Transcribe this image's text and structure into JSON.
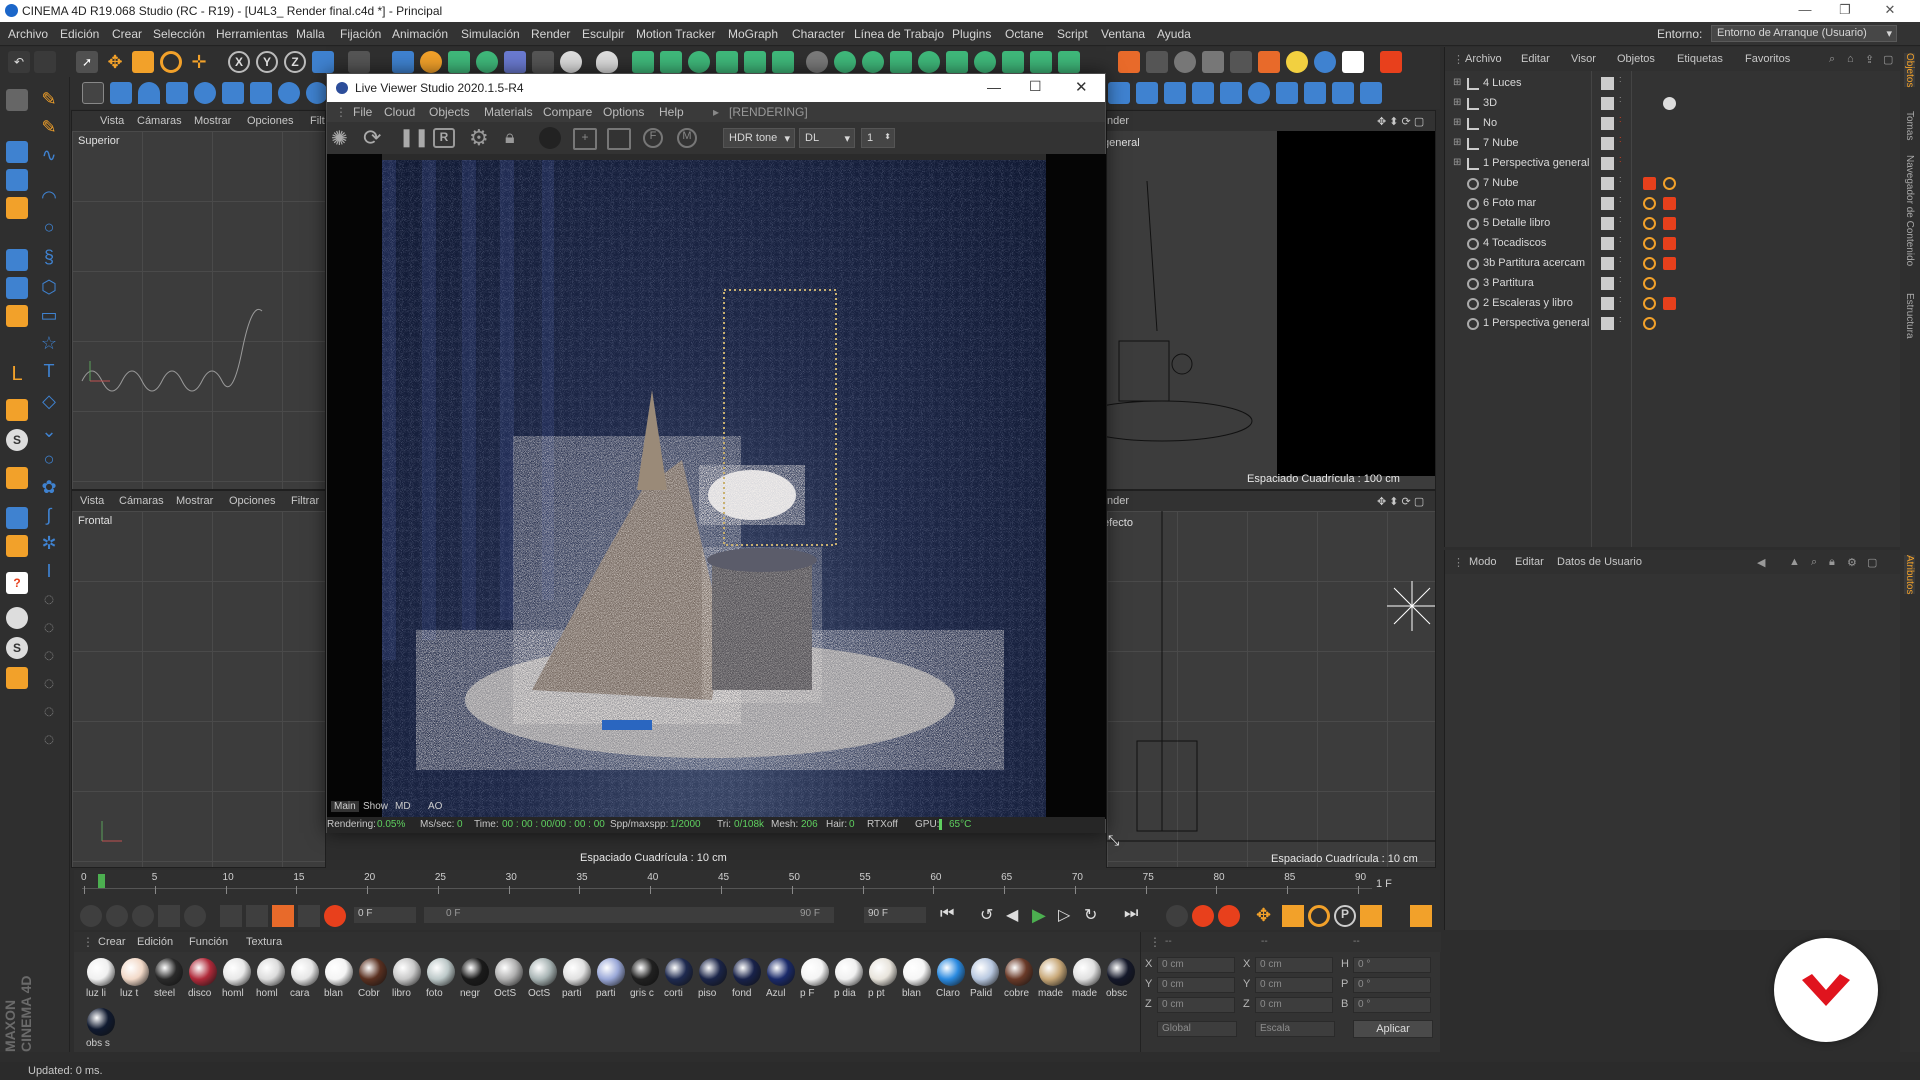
{
  "window": {
    "title": "CINEMA 4D R19.068 Studio (RC - R19) - [U4L3_ Render final.c4d *] - Principal"
  },
  "menubar": {
    "items": [
      "Archivo",
      "Edición",
      "Crear",
      "Selección",
      "Herramientas",
      "Malla",
      "Fijación",
      "Animación",
      "Simulación",
      "Render",
      "Esculpir",
      "Motion Tracker",
      "MoGraph",
      "Character",
      "Línea de Trabajo",
      "Plugins",
      "Octane",
      "Script",
      "Ventana",
      "Ayuda"
    ],
    "entorno_label": "Entorno:",
    "entorno_value": "Entorno de Arranque (Usuario)"
  },
  "viewports": {
    "top_left": {
      "menu": [
        "Vista",
        "Cámaras",
        "Mostrar",
        "Opciones",
        "Filt"
      ],
      "label": "Superior"
    },
    "bottom_left": {
      "menu": [
        "Vista",
        "Cámaras",
        "Mostrar",
        "Opciones",
        "Filtrar"
      ],
      "label": "Frontal",
      "grid_spacing": "Espaciado Cuadrícula : 10 cm"
    },
    "top_right": {
      "header": "nder",
      "camera": "general",
      "grid_spacing": "Espaciado Cuadrícula : 100 cm"
    },
    "bottom_right": {
      "header": "nder",
      "camera": "efecto",
      "grid_spacing": "Espaciado Cuadrícula : 10 cm"
    }
  },
  "live_viewer": {
    "title": "Live Viewer Studio 2020.1.5-R4",
    "menu": [
      "File",
      "Cloud",
      "Objects",
      "Materials",
      "Compare",
      "Options",
      "Help"
    ],
    "state": "[RENDERING]",
    "tone": "HDR tone",
    "kernel": "DL",
    "count": "1",
    "tabs": [
      "Main",
      "Show",
      "MD",
      "AO"
    ],
    "status": {
      "rendering_label": "Rendering:",
      "rendering_value": "0.05%",
      "mssec_label": "Ms/sec:",
      "mssec_value": "0",
      "time_label": "Time:",
      "time_value": "00 : 00 : 00/00 : 00 : 00",
      "spp_label": "Spp/maxspp:",
      "spp_value": "1/2000",
      "tri_label": "Tri:",
      "tri_value": "0/108k",
      "mesh_label": "Mesh:",
      "mesh_value": "206",
      "hair_label": "Hair:",
      "hair_value": "0",
      "rtx": "RTXoff",
      "gpu_label": "GPU:",
      "gpu_temp": "65°C"
    }
  },
  "object_manager": {
    "menu": [
      "Archivo",
      "Editar",
      "Visor",
      "Objetos",
      "Etiquetas",
      "Favoritos"
    ],
    "rows": [
      {
        "name": "4 Luces",
        "kind": "layer"
      },
      {
        "name": "3D",
        "kind": "layer"
      },
      {
        "name": "No",
        "kind": "layer"
      },
      {
        "name": "7 Nube",
        "kind": "layer"
      },
      {
        "name": "1 Perspectiva general",
        "kind": "layer"
      },
      {
        "name": "7 Nube",
        "kind": "take"
      },
      {
        "name": "6 Foto mar",
        "kind": "take"
      },
      {
        "name": "5 Detalle libro",
        "kind": "take"
      },
      {
        "name": "4 Tocadiscos",
        "kind": "take"
      },
      {
        "name": "3b Partitura acercam",
        "kind": "take"
      },
      {
        "name": "3 Partitura",
        "kind": "take"
      },
      {
        "name": "2 Escaleras y libro",
        "kind": "take"
      },
      {
        "name": "1 Perspectiva general",
        "kind": "take"
      }
    ]
  },
  "attribute_manager": {
    "menu": [
      "Modo",
      "Editar",
      "Datos de Usuario"
    ]
  },
  "right_sidebar": [
    "Objetos",
    "Tomas",
    "Navegador de Contenido",
    "Estructura",
    "Atributos"
  ],
  "timeline": {
    "ticks": [
      "0",
      "5",
      "10",
      "15",
      "20",
      "25",
      "30",
      "35",
      "40",
      "45",
      "50",
      "55",
      "60",
      "65",
      "70",
      "75",
      "80",
      "85",
      "90"
    ],
    "current_frame": "1 F",
    "start_field": "0 F",
    "range_start": "0 F",
    "range_end": "90 F",
    "end_field": "90 F"
  },
  "material_manager": {
    "menu": [
      "Crear",
      "Edición",
      "Función",
      "Textura"
    ],
    "materials": [
      {
        "label": "luz li",
        "color": "#f0f0f0"
      },
      {
        "label": "luz t",
        "color": "#f2d9c8"
      },
      {
        "label": "steel",
        "color": "#2a2a2a"
      },
      {
        "label": "disco",
        "color": "#b02a3a"
      },
      {
        "label": "homl",
        "color": "#e8e8e8"
      },
      {
        "label": "homl",
        "color": "#dcdcdc"
      },
      {
        "label": "cara",
        "color": "#e6e6e6"
      },
      {
        "label": "blan",
        "color": "#f4f4f4"
      },
      {
        "label": "Cobr",
        "color": "#5a3020"
      },
      {
        "label": "libro",
        "color": "#c8c8c8"
      },
      {
        "label": "foto",
        "color": "#bcc8c8"
      },
      {
        "label": "negr",
        "color": "#1a1a1a"
      },
      {
        "label": "OctS",
        "color": "#b0b0b0"
      },
      {
        "label": "OctS",
        "color": "#a8b4b4"
      },
      {
        "label": "parti",
        "color": "#e0e0e0"
      },
      {
        "label": "parti",
        "color": "#9aa8d8"
      },
      {
        "label": "gris c",
        "color": "#202020"
      },
      {
        "label": "corti",
        "color": "#1e2a50"
      },
      {
        "label": "piso",
        "color": "#1a2448"
      },
      {
        "label": "fond",
        "color": "#18224a"
      },
      {
        "label": "Azul",
        "color": "#1a2a6a"
      },
      {
        "label": "p F",
        "color": "#f4f4f4"
      },
      {
        "label": "p dia",
        "color": "#f0f0f0"
      },
      {
        "label": "p pt",
        "color": "#e8e4dc"
      },
      {
        "label": "blan",
        "color": "#f6f6f6"
      },
      {
        "label": "Claro",
        "color": "#2a8ae0"
      },
      {
        "label": "Palid",
        "color": "#b8c8e0"
      },
      {
        "label": "cobre",
        "color": "#6a3a28"
      },
      {
        "label": "made",
        "color": "#c8a878"
      },
      {
        "label": "made",
        "color": "#e0e0e0"
      },
      {
        "label": "obsc",
        "color": "#14182a"
      },
      {
        "label": "obs s",
        "color": "#101a30"
      }
    ]
  },
  "coordinates": {
    "header": [
      "--",
      "--",
      "--"
    ],
    "rows": [
      {
        "a": "X",
        "av": "0 cm",
        "b": "X",
        "bv": "0 cm",
        "c": "H",
        "cv": "0 °"
      },
      {
        "a": "Y",
        "av": "0 cm",
        "b": "Y",
        "bv": "0 cm",
        "c": "P",
        "cv": "0 °"
      },
      {
        "a": "Z",
        "av": "0 cm",
        "b": "Z",
        "bv": "0 cm",
        "c": "B",
        "cv": "0 °"
      }
    ],
    "mode1": "Global",
    "mode2": "Escala",
    "apply": "Aplicar"
  },
  "status": {
    "text": "Updated: 0 ms."
  },
  "brand": {
    "logo_text": "MAXON CINEMA 4D",
    "badge_color": "#e0141e"
  },
  "colors": {
    "accent": "#3f82d0",
    "tag_orange": "#f2a12a",
    "tag_red": "#e8401c"
  }
}
